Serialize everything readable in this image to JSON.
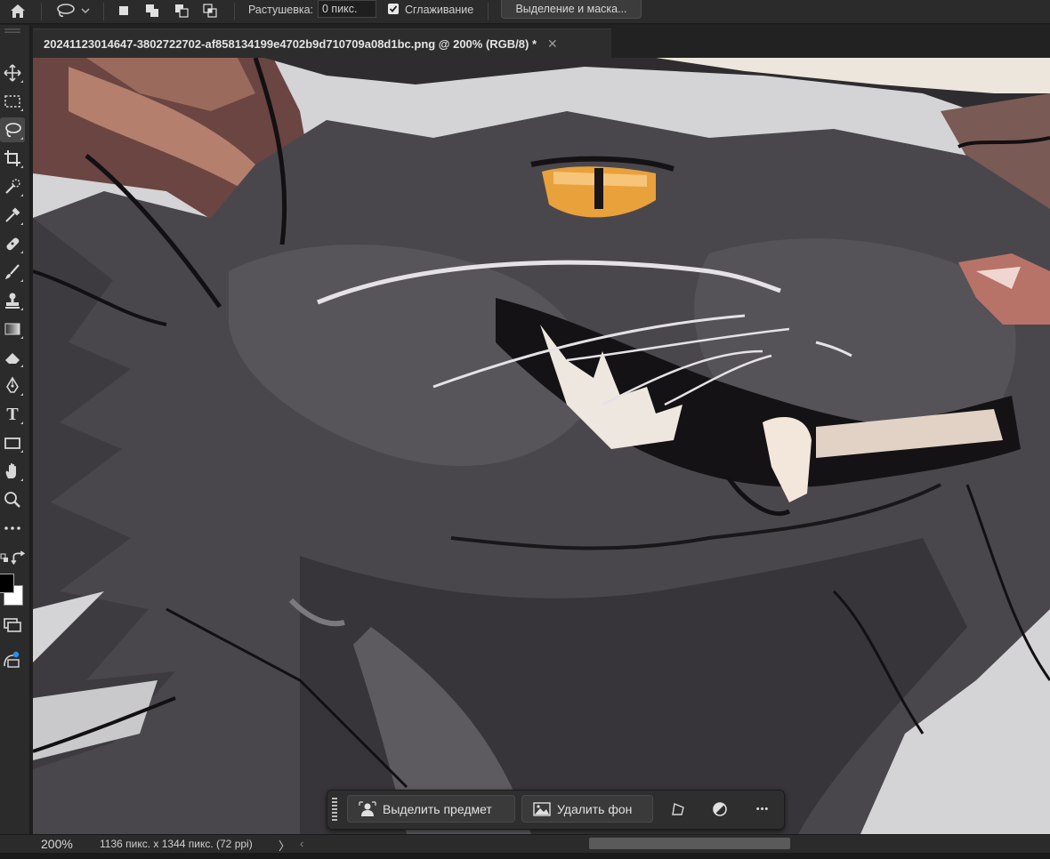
{
  "options_bar": {
    "home_icon": "home-icon",
    "lasso_icon": "lasso-icon",
    "selection_modes": [
      "new-selection-icon",
      "add-to-selection-icon",
      "subtract-from-selection-icon",
      "intersect-selection-icon"
    ],
    "feather_label": "Растушевка:",
    "feather_value": "0 пикс.",
    "antialias_label": "Сглаживание",
    "antialias_checked": true,
    "select_and_mask_label": "Выделение и маска..."
  },
  "document_tab": {
    "title": "20241123014647-3802722702-af858134199e4702b9d710709a08d1bc.png @ 200% (RGB/8) *",
    "close_glyph": "✕"
  },
  "toolbar": {
    "tools": [
      "move-tool-icon",
      "marquee-tool-icon",
      "lasso-tool-icon",
      "crop-tool-icon",
      "quick-selection-icon",
      "eyedropper-icon",
      "healing-brush-icon",
      "brush-icon",
      "clone-stamp-icon",
      "gradient-icon",
      "eraser-icon",
      "pen-icon",
      "type-icon",
      "rectangle-icon",
      "hand-icon",
      "zoom-icon",
      "more-tools-icon"
    ],
    "active_tool": "lasso-tool-icon",
    "type_glyph": "T",
    "foreground_color": "#000000",
    "background_color": "#ffffff"
  },
  "task_bar": {
    "select_subject_label": "Выделить предмет",
    "remove_bg_label": "Удалить фон",
    "icons": [
      "person-select-icon",
      "remove-background-icon",
      "transform-icon",
      "adjustment-icon",
      "more-icon"
    ],
    "more_glyph": "•••"
  },
  "status_bar": {
    "zoom": "200%",
    "doc_info": "1136 пикс. x 1344 пикс. (72 ppi)",
    "arrow": "〉",
    "scroll_left": "‹"
  },
  "canvas": {
    "background": "#d3d2d4",
    "fur_color": "#4a474c",
    "eye_color": "#e9a13b"
  }
}
